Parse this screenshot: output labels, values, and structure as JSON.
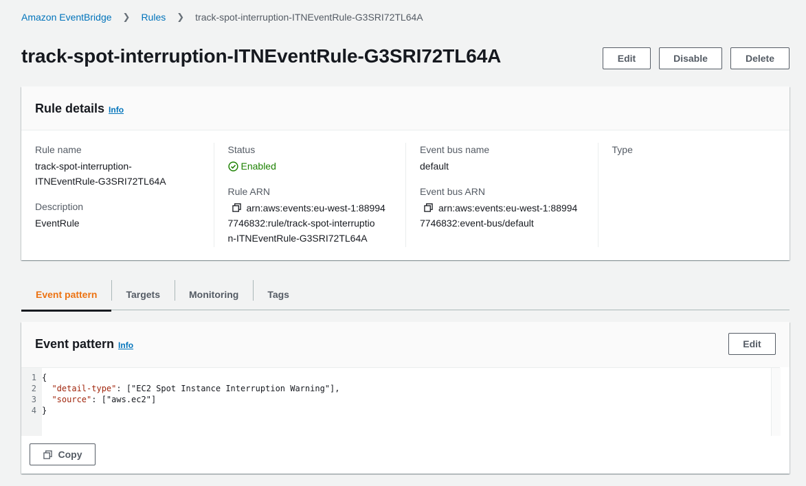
{
  "breadcrumb": {
    "root": "Amazon EventBridge",
    "section": "Rules",
    "current": "track-spot-interruption-ITNEventRule-G3SRI72TL64A"
  },
  "page": {
    "title": "track-spot-interruption-ITNEventRule-G3SRI72TL64A",
    "edit_label": "Edit",
    "disable_label": "Disable",
    "delete_label": "Delete"
  },
  "rule_details": {
    "title": "Rule details",
    "info": "Info",
    "rule_name_label": "Rule name",
    "rule_name_line1": "track-spot-interruption-",
    "rule_name_line2": "ITNEventRule-G3SRI72TL64A",
    "description_label": "Description",
    "description": "EventRule",
    "status_label": "Status",
    "status": "Enabled",
    "rule_arn_label": "Rule ARN",
    "rule_arn_line1": "arn:aws:events:eu-west-1:88994",
    "rule_arn_line2": "7746832:rule/track-spot-interruptio",
    "rule_arn_line3": "n-ITNEventRule-G3SRI72TL64A",
    "event_bus_name_label": "Event bus name",
    "event_bus_name": "default",
    "event_bus_arn_label": "Event bus ARN",
    "event_bus_arn_line1": "arn:aws:events:eu-west-1:88994",
    "event_bus_arn_line2": "7746832:event-bus/default",
    "type_label": "Type"
  },
  "tabs": [
    "Event pattern",
    "Targets",
    "Monitoring",
    "Tags"
  ],
  "event_pattern": {
    "title": "Event pattern",
    "info": "Info",
    "edit_label": "Edit",
    "copy_label": "Copy",
    "line_numbers": [
      "1",
      "2",
      "3",
      "4"
    ],
    "code": {
      "l1": "{",
      "l2_key": "\"detail-type\"",
      "l2_rest": ": [\"EC2 Spot Instance Interruption Warning\"],",
      "l3_key": "\"source\"",
      "l3_rest": ": [\"aws.ec2\"]",
      "l4": "}"
    }
  },
  "colors": {
    "link": "#0073bb",
    "success": "#1d8102",
    "tab_active": "#ec7211"
  }
}
